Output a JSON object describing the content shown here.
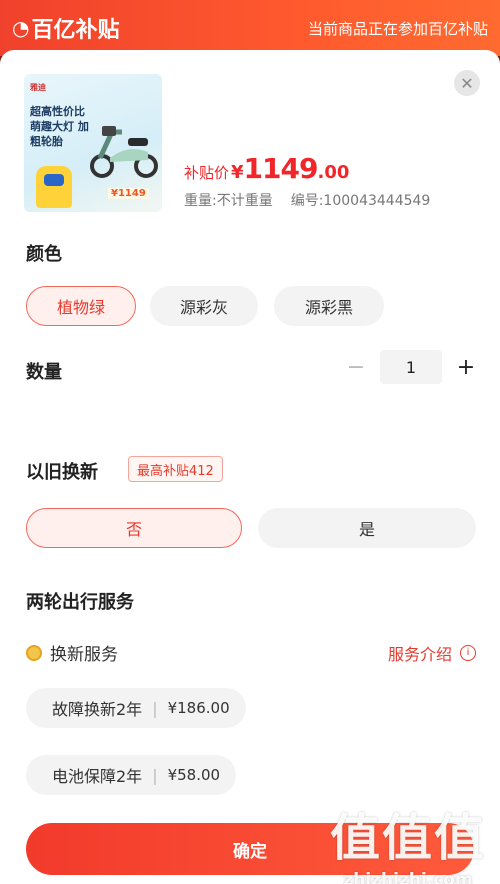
{
  "header": {
    "brand": "百亿补贴",
    "notice": "当前商品正在参加百亿补贴"
  },
  "product": {
    "image_tag": "雅迪",
    "image_slogan": "超高性价比 萌趣大灯 加粗轮胎",
    "image_price": "¥1149",
    "price_label": "补贴价",
    "currency": "¥",
    "price_int": "1149",
    "price_dec": ".00",
    "weight": "重量:不计重量",
    "sku": "编号:100043444549"
  },
  "color": {
    "title": "颜色",
    "options": [
      "植物绿",
      "源彩灰",
      "源彩黑"
    ],
    "selected": "植物绿"
  },
  "quantity": {
    "title": "数量",
    "value": "1",
    "minus": "−",
    "plus": "+"
  },
  "trade_in": {
    "title": "以旧换新",
    "badge": "最高补贴412",
    "options": [
      "否",
      "是"
    ],
    "selected": "否"
  },
  "service": {
    "title": "两轮出行服务",
    "sub_title": "换新服务",
    "intro_link": "服务介绍",
    "options": [
      {
        "name": "故障换新2年",
        "price": "¥186.00"
      },
      {
        "name": "电池保障2年",
        "price": "¥58.00"
      }
    ]
  },
  "confirm_label": "确定",
  "watermark": {
    "glyphs": "值值值",
    "site": "zhizhizhi.com"
  },
  "colors": {
    "accent": "#f1262b",
    "selected_bg": "#fff0ee",
    "chip_bg": "#f3f3f3"
  },
  "icons": {
    "close": "close-icon",
    "info": "info-icon",
    "coin": "coin-icon"
  }
}
